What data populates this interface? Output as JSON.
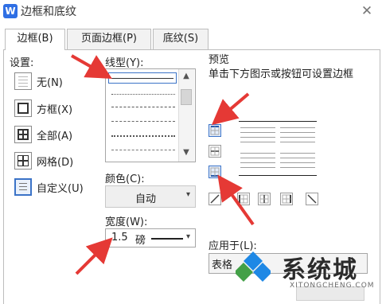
{
  "window": {
    "app_icon_letter": "W",
    "title": "边框和底纹",
    "close_glyph": "✕"
  },
  "tabs": [
    {
      "label": "边框(B)",
      "active": true
    },
    {
      "label": "页面边框(P)",
      "active": false
    },
    {
      "label": "底纹(S)",
      "active": false
    }
  ],
  "settings": {
    "label": "设置:",
    "items": [
      {
        "label": "无(N)",
        "icon": "setting-none-icon"
      },
      {
        "label": "方框(X)",
        "icon": "setting-box-icon"
      },
      {
        "label": "全部(A)",
        "icon": "setting-all-icon"
      },
      {
        "label": "网格(D)",
        "icon": "setting-grid-icon"
      },
      {
        "label": "自定义(U)",
        "icon": "setting-custom-icon",
        "selected": true
      }
    ]
  },
  "line_style": {
    "label": "线型(Y):",
    "scroll_up_glyph": "▲",
    "scroll_down_glyph": "▼"
  },
  "color": {
    "label": "颜色(C):",
    "value": "自动",
    "caret": "▾"
  },
  "width": {
    "label": "宽度(W):",
    "value": "1.5",
    "unit": "磅",
    "caret": "▾"
  },
  "preview": {
    "label": "预览",
    "hint": "单击下方图示或按钮可设置边框"
  },
  "apply_to": {
    "label": "应用于(L):",
    "value": "表格"
  },
  "watermark": {
    "text": "系统城",
    "sub": "XITONGCHENG.COM"
  },
  "colors": {
    "accent": "#3b73c7",
    "annotation_arrow": "#e53935",
    "logo_blue": "#1e88e5",
    "logo_green": "#43a047"
  }
}
